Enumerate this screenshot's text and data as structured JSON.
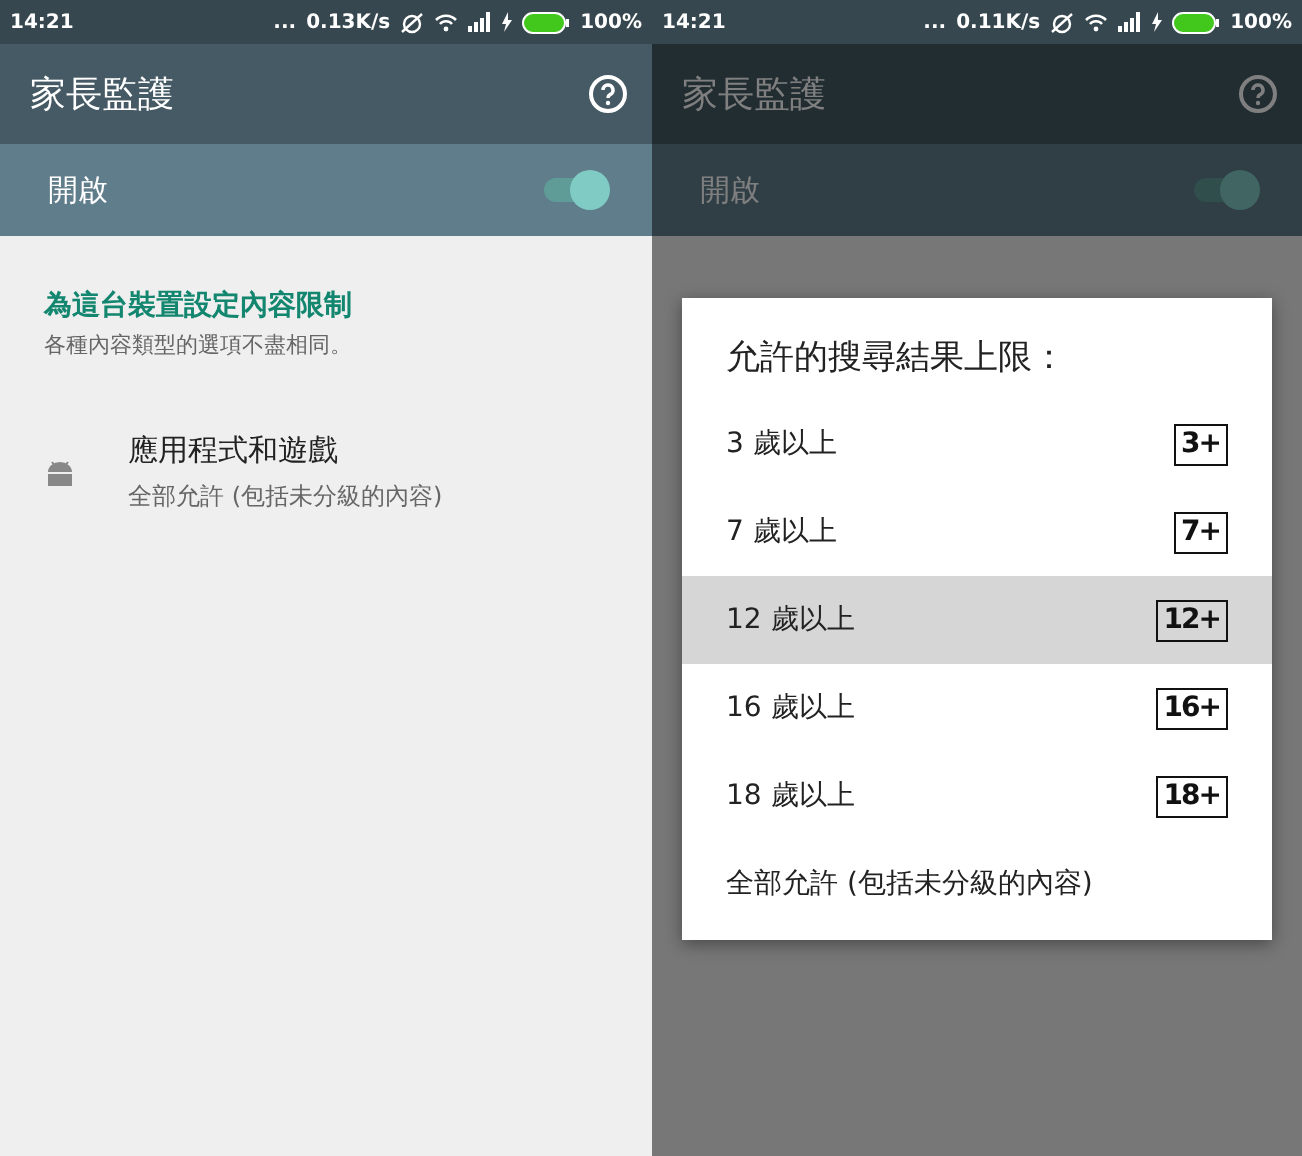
{
  "screens": [
    {
      "status_bar": {
        "time": "14:21",
        "more": "...",
        "speed": "0.13K/s",
        "battery": "100%"
      },
      "app_bar": {
        "title": "家長監護"
      },
      "master_toggle": {
        "label": "開啟",
        "on": true
      },
      "section": {
        "title": "為這台裝置設定內容限制",
        "subtitle": "各種內容類型的選項不盡相同。"
      },
      "items": [
        {
          "title": "應用程式和遊戲",
          "subtitle": "全部允許 (包括未分級的內容)"
        }
      ]
    },
    {
      "status_bar": {
        "time": "14:21",
        "more": "...",
        "speed": "0.11K/s",
        "battery": "100%"
      },
      "app_bar": {
        "title": "家長監護"
      },
      "master_toggle": {
        "label": "開啟",
        "on": true
      },
      "dialog": {
        "title": "允許的搜尋結果上限：",
        "options": [
          {
            "label": "3 歲以上",
            "badge": "3+",
            "selected": false
          },
          {
            "label": "7 歲以上",
            "badge": "7+",
            "selected": false
          },
          {
            "label": "12 歲以上",
            "badge": "12+",
            "selected": true
          },
          {
            "label": "16 歲以上",
            "badge": "16+",
            "selected": false
          },
          {
            "label": "18 歲以上",
            "badge": "18+",
            "selected": false
          },
          {
            "label": "全部允許 (包括未分級的內容)",
            "selected": false
          }
        ]
      }
    }
  ]
}
